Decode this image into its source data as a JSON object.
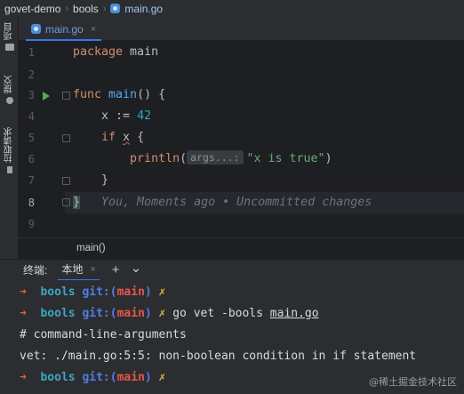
{
  "breadcrumb": {
    "project": "govet-demo",
    "folder": "bools",
    "file": "main.go"
  },
  "left_strip": {
    "items": [
      "项目",
      "提交",
      "拉取请求"
    ]
  },
  "editor_tab": {
    "label": "main.go",
    "close": "×"
  },
  "code": {
    "line_numbers": [
      "1",
      "2",
      "3",
      "4",
      "5",
      "6",
      "7",
      "8",
      "9"
    ],
    "active_line": "8",
    "l1_kw": "package",
    "l1_name": " main",
    "l3_kw": "func",
    "l3_fn": " main",
    "l3_rest": "() {",
    "l4_pre": "    x := ",
    "l4_num": "42",
    "l5_kw": "    if ",
    "l5_var": "x",
    "l5_rest": " {",
    "l6_indent": "        ",
    "l6_fn": "println",
    "l6_open": "(",
    "l6_hint": "args...:",
    "l6_str": "\"x is true\"",
    "l6_close": ")",
    "l7": "    }",
    "l8_brace": "}",
    "l8_blame": "   You, Moments ago • Uncommitted changes"
  },
  "scope": {
    "label": "main()"
  },
  "terminal": {
    "title": "终端:",
    "tab_label": "本地",
    "tab_close": "×",
    "add": "+",
    "dropdown": "⌄",
    "prompt_arrow": "➜",
    "dir": "bools",
    "git_pre": " git:(",
    "branch": "main",
    "git_post": ")",
    "dirty": " ✗",
    "cmd_pre": " go vet -bools ",
    "cmd_file": "main.go",
    "out1": "# command-line-arguments",
    "out2": "vet: ./main.go:5:5: non-boolean condition in if statement"
  },
  "watermark": "@稀土掘金技术社区",
  "colors": {
    "background": "#2b2d30",
    "editor": "#1e1f22",
    "keyword": "#cf8e6d",
    "function": "#56a8f5",
    "number": "#2aacb8",
    "string": "#6aab73",
    "accent": "#3574f0"
  }
}
